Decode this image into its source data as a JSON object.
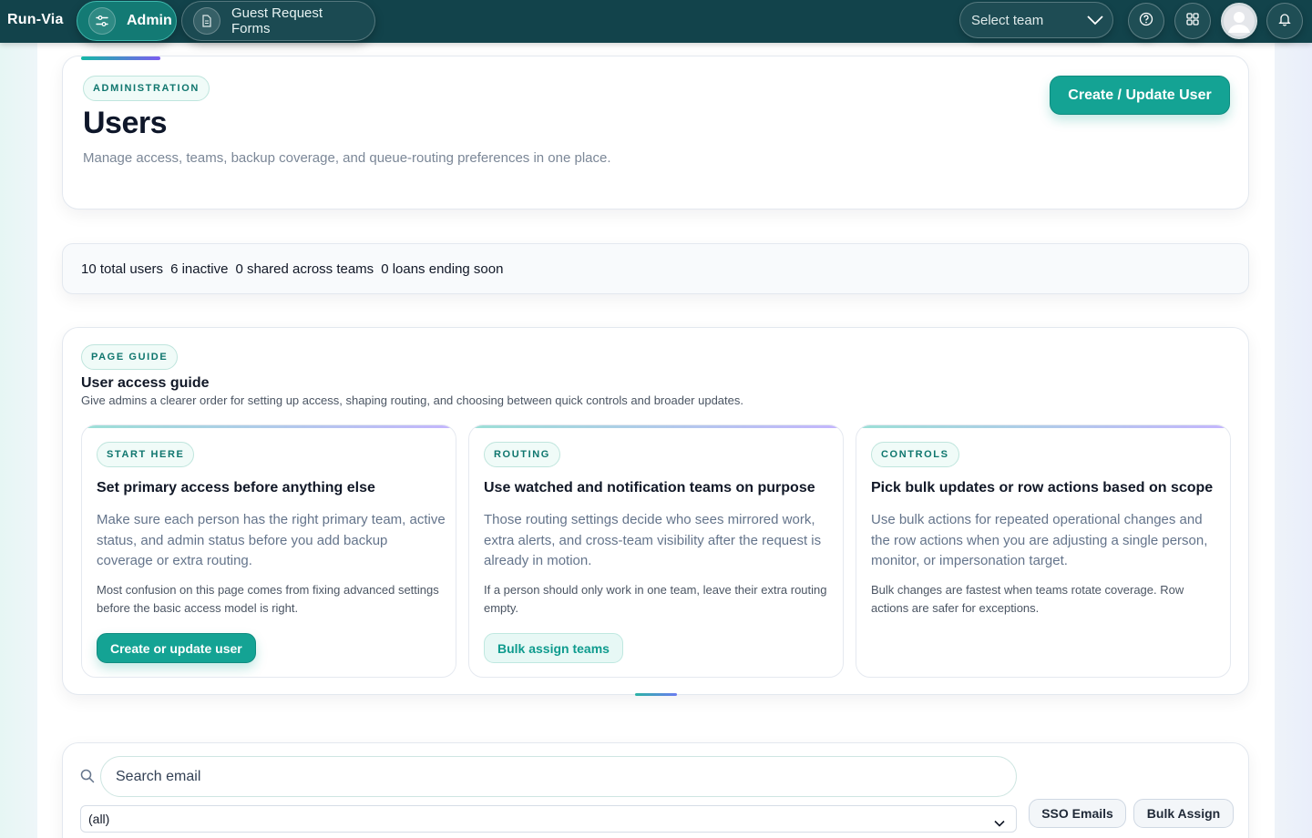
{
  "app": {
    "brand": "Run-Via"
  },
  "nav": {
    "tabs": [
      {
        "label": "Admin",
        "icon": "sliders-icon",
        "active": true
      },
      {
        "label": "Guest Request Forms",
        "icon": "document-icon",
        "active": false
      }
    ],
    "team_select": {
      "label": "Select team"
    },
    "actions": [
      {
        "icon": "help-icon"
      },
      {
        "icon": "apps-grid-icon"
      },
      {
        "icon": "avatar"
      },
      {
        "icon": "bell-icon"
      }
    ]
  },
  "hero": {
    "eyebrow": "ADMINISTRATION",
    "title": "Users",
    "description": "Manage access, teams, backup coverage, and queue-routing preferences in one place.",
    "primary_button": "Create / Update User"
  },
  "stats": {
    "total": "10 total users",
    "inactive": "6 inactive",
    "shared": "0 shared across teams",
    "loans": "0 loans ending soon"
  },
  "guide": {
    "eyebrow": "PAGE GUIDE",
    "title": "User access guide",
    "subtitle": "Give admins a clearer order for setting up access, shaping routing, and choosing between quick controls and broader updates.",
    "cards": [
      {
        "tag": "START HERE",
        "title": "Set primary access before anything else",
        "body": "Make sure each person has the right primary team, active status, and admin status before you add backup coverage or extra routing.",
        "note": "Most confusion on this page comes from fixing advanced settings before the basic access model is right.",
        "button": "Create or update user"
      },
      {
        "tag": "ROUTING",
        "title": "Use watched and notification teams on purpose",
        "body": "Those routing settings decide who sees mirrored work, extra alerts, and cross-team visibility after the request is already in motion.",
        "note": "If a person should only work in one team, leave their extra routing empty.",
        "button": "Bulk assign teams"
      },
      {
        "tag": "CONTROLS",
        "title": "Pick bulk updates or row actions based on scope",
        "body": "Use bulk actions for repeated operational changes and the row actions when you are adjusting a single person, monitor, or impersonation target.",
        "note": "Bulk changes are fastest when teams rotate coverage. Row actions are safer for exceptions."
      }
    ]
  },
  "filters": {
    "search_placeholder": "Search email",
    "select_value": "(all)",
    "sso_button": "SSO Emails",
    "bulk_button": "Bulk Assign"
  },
  "colors": {
    "topbar": "#12434b",
    "accent": "#14a394",
    "chip_text": "#0f766e"
  }
}
